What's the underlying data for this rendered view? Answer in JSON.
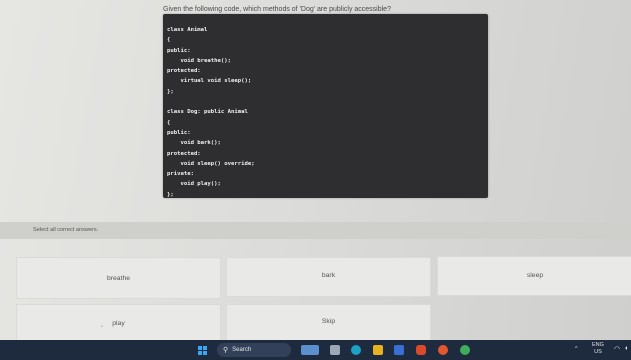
{
  "question": "Given the following code, which methods of 'Dog' are publicly accessible?",
  "code": "class Animal\n{\npublic:\n    void breathe();\nprotected:\n    virtual void sleep();\n};\n\nclass Dog: public Animal\n{\npublic:\n    void bark();\nprotected:\n    void sleep() override;\nprivate:\n    void play();\n};",
  "instruction": "Select all correct answers.",
  "options": [
    "breathe",
    "bark",
    "sleep",
    "play",
    "Skip"
  ],
  "taskbar": {
    "search_label": "Search",
    "lang_top": "ENG",
    "lang_bottom": "US"
  }
}
